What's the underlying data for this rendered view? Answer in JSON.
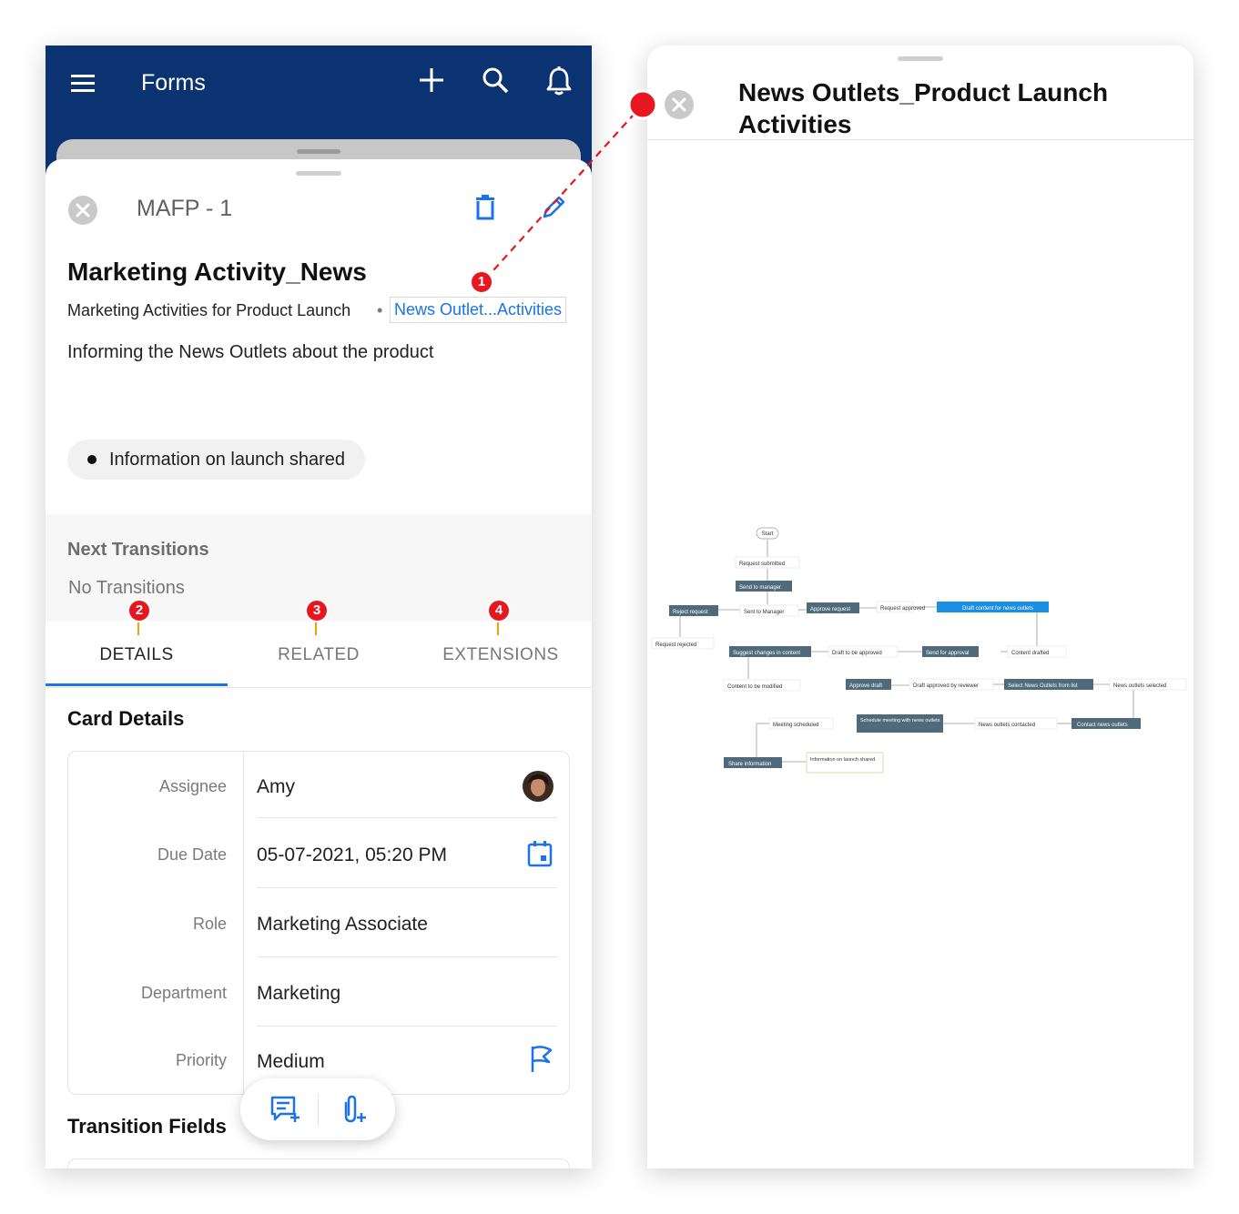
{
  "left": {
    "appbar": {
      "title": "Forms",
      "icons": [
        "menu-icon",
        "add-icon",
        "search-icon",
        "bell-icon"
      ]
    },
    "card": {
      "id": "MAFP - 1",
      "title": "Marketing Activity_News",
      "parent": "Marketing Activities for Product Launch",
      "separator": "•",
      "link": "News Outlet...Activities",
      "description": "Informing the News Outlets about the product",
      "status": "Information on launch shared"
    },
    "transitions": {
      "title": "Next Transitions",
      "empty": "No Transitions"
    },
    "tabs": [
      {
        "label": "DETAILS",
        "active": true
      },
      {
        "label": "RELATED",
        "active": false
      },
      {
        "label": "EXTENSIONS",
        "active": false
      }
    ],
    "card_details": {
      "title": "Card Details",
      "rows": [
        {
          "label": "Assignee",
          "value": "Amy"
        },
        {
          "label": "Due Date",
          "value": "05-07-2021, 05:20 PM"
        },
        {
          "label": "Role",
          "value": "Marketing Associate"
        },
        {
          "label": "Department",
          "value": "Marketing"
        },
        {
          "label": "Priority",
          "value": "Medium"
        }
      ]
    },
    "transition_fields": {
      "title": "Transition Fields"
    }
  },
  "right": {
    "title": "News Outlets_Product Launch Activities",
    "workflow": {
      "start": "Start",
      "states": [
        "Request submitted",
        "Sent to Manager",
        "Request approved",
        "Request rejected",
        "Draft to be approved",
        "Content drafted",
        "Content to be modified",
        "Draft approved by reviewer",
        "News outlets selected",
        "Meeting scheduled",
        "News outlets contacted",
        "Information on launch shared"
      ],
      "actions": [
        "Send to manager",
        "Reject request",
        "Approve request",
        "Draft content for news outlets",
        "Suggest changes in content",
        "Send for approval",
        "Approve draft",
        "Select News Outlets from list",
        "Schedule meeting with news outlets",
        "Contact news outlets",
        "Share information"
      ]
    }
  },
  "markers": [
    "1",
    "2",
    "3",
    "4"
  ],
  "colors": {
    "appbar": "#0b3372",
    "accent": "#1a73e8",
    "marker": "#e8161f",
    "node": "#4f6a7a"
  }
}
